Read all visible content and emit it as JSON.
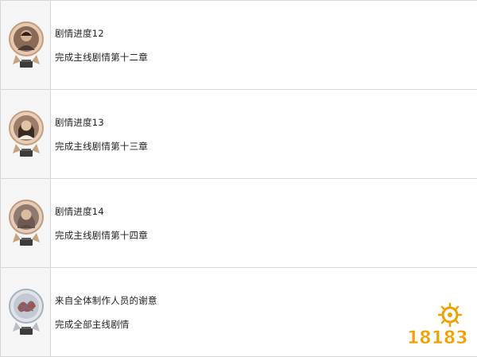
{
  "rows": [
    {
      "title": "剧情进度12",
      "desc": "完成主线剧情第十二章",
      "medal": "medal-portrait-man-icon"
    },
    {
      "title": "剧情进度13",
      "desc": "完成主线剧情第十三章",
      "medal": "medal-portrait-woman-icon"
    },
    {
      "title": "剧情进度14",
      "desc": "完成主线剧情第十四章",
      "medal": "medal-portrait-woman-icon"
    },
    {
      "title": "来自全体制作人员的谢意",
      "desc": "完成全部主线剧情",
      "medal": "medal-silver-emblem-icon"
    }
  ],
  "watermark": {
    "text": "18183",
    "icon": "sun-logo-icon"
  },
  "colors": {
    "border": "#d6d6d6",
    "icon_cell_bg": "#f5f5f5",
    "watermark": "#f0a000"
  }
}
